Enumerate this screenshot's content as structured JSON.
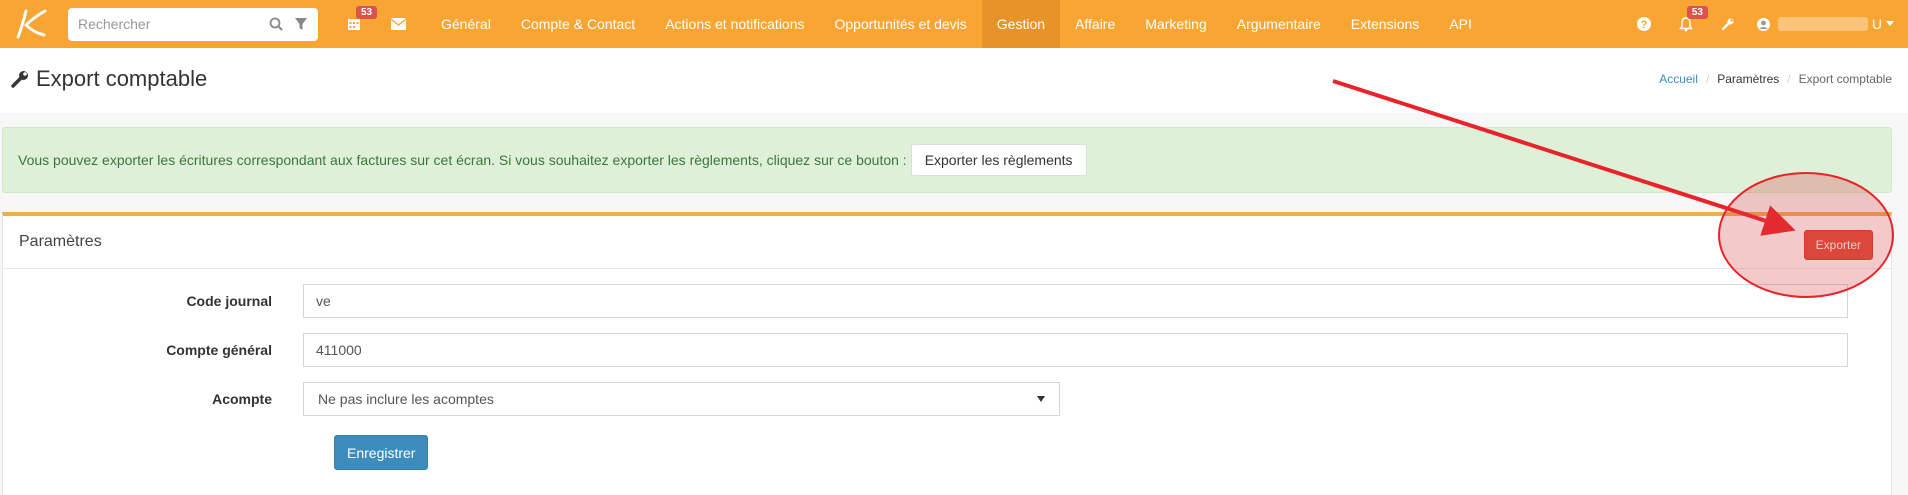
{
  "navbar": {
    "logo": "k-logo",
    "search_placeholder": "Rechercher",
    "calendar_badge": "53",
    "notification_badge": "53",
    "menu": [
      {
        "label": "Général",
        "active": false
      },
      {
        "label": "Compte & Contact",
        "active": false
      },
      {
        "label": "Actions et notifications",
        "active": false
      },
      {
        "label": "Opportunités et devis",
        "active": false
      },
      {
        "label": "Gestion",
        "active": true
      },
      {
        "label": "Affaire",
        "active": false
      },
      {
        "label": "Marketing",
        "active": false
      },
      {
        "label": "Argumentaire",
        "active": false
      },
      {
        "label": "Extensions",
        "active": false
      },
      {
        "label": "API",
        "active": false
      }
    ],
    "user_initial": "U"
  },
  "page": {
    "title": "Export comptable",
    "breadcrumb": [
      "Accueil",
      "Paramètres",
      "Export comptable"
    ]
  },
  "alert": {
    "text": "Vous pouvez exporter les écritures correspondant aux factures sur cet écran. Si vous souhaitez exporter les règlements, cliquez sur ce bouton :",
    "button_label": "Exporter les règlements"
  },
  "panel": {
    "title": "Paramètres",
    "export_label": "Exporter",
    "fields": {
      "code_journal": {
        "label": "Code journal",
        "value": "ve"
      },
      "compte_general": {
        "label": "Compte général",
        "value": "411000"
      },
      "acompte": {
        "label": "Acompte",
        "value": "Ne pas inclure les acomptes"
      }
    },
    "save_label": "Enregistrer"
  },
  "colors": {
    "navbar": "#f9a534",
    "active_menu": "#e8932a",
    "alert_bg": "#dff0d8",
    "danger": "#dd4b39",
    "primary": "#3c8dbc",
    "annotation": "#e8232a"
  }
}
